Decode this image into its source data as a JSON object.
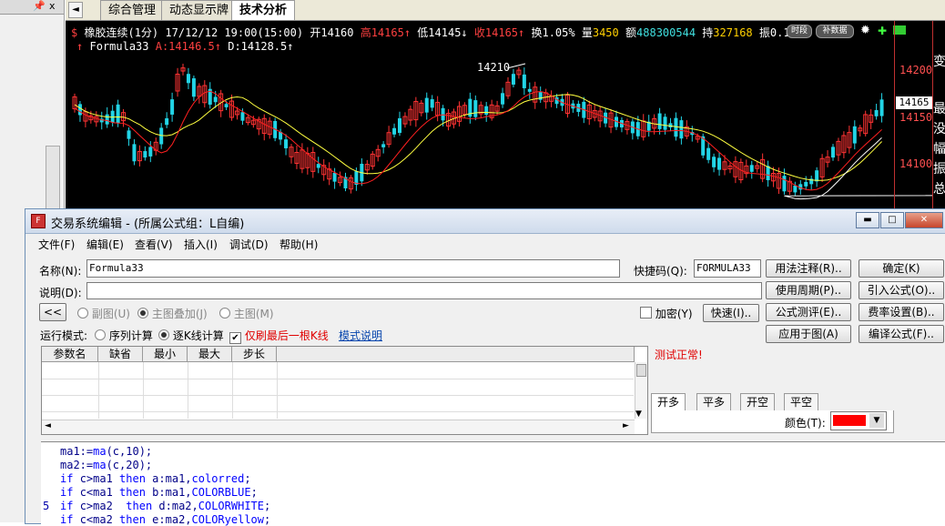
{
  "left_panel": {
    "pin_icon": "pin-icon",
    "close_label": "x"
  },
  "tabs": {
    "arrow": "◄",
    "items": [
      {
        "label": "综合管理"
      },
      {
        "label": "动态显示牌"
      },
      {
        "label": "技术分析"
      }
    ]
  },
  "chart": {
    "info_line1": {
      "dollar": "$",
      "name": "橡胶连续(1分)",
      "datetime": "17/12/12 19:00(15:00)",
      "open_label": "开14160",
      "high_label": "高14165",
      "low_label": "低14145",
      "close_label": "收14165",
      "turnover": "换1.05%",
      "volume_label": "量",
      "volume_value": "3450",
      "amount_label": "额",
      "amount_value": "488300544",
      "hold_label": "持",
      "hold_value": "327168",
      "amplitude": "振0.1",
      "btn_timeframe": "时段",
      "btn_supplement": "补数据"
    },
    "info_line2": {
      "formula": "Formula33",
      "a_value": "A:14146.5",
      "d_value": "D:14128.5"
    },
    "peak_label": "14210",
    "price_axis": [
      {
        "label": "14200"
      },
      {
        "label": "14150"
      },
      {
        "label": "14100"
      }
    ],
    "current_price": "14165",
    "right_chars": [
      "变",
      "最",
      "没",
      "幅",
      "振",
      "总"
    ],
    "colors": {
      "up": "#ff3333",
      "down": "#22d4e6",
      "ma1": "#ffff40",
      "ma2": "#ffffff",
      "ma_red": "#ff2020"
    }
  },
  "chart_data": {
    "type": "line",
    "title": "橡胶连续(1分)",
    "y_axis_ticks": [
      14200,
      14150,
      14100
    ],
    "annotations": [
      "14210",
      "14165"
    ],
    "series": [
      {
        "name": "A",
        "last_value": 14146.5
      },
      {
        "name": "D",
        "last_value": 14128.5
      }
    ]
  },
  "dialog": {
    "title": "交易系统编辑 - (所属公式组：L自编)",
    "window_buttons": {
      "minimize": "▬",
      "maximize": "□",
      "close": "✕"
    },
    "menu": [
      "文件(F)",
      "编辑(E)",
      "查看(V)",
      "插入(I)",
      "调试(D)",
      "帮助(H)"
    ],
    "name_label": "名称(N):",
    "name_value": "Formula33",
    "shortcut_label": "快捷码(Q):",
    "shortcut_value": "FORMULA33",
    "desc_label": "说明(D):",
    "desc_value": "",
    "collapse_button": "<<",
    "chart_type_options": [
      {
        "label": "副图(U)",
        "selected": false
      },
      {
        "label": "主图叠加(J)",
        "selected": true
      },
      {
        "label": "主图(M)",
        "selected": false
      }
    ],
    "encrypt_label": "加密(Y)",
    "quick_button": "快速(I)..",
    "run_mode_label": "运行模式:",
    "run_mode_options": [
      {
        "label": "序列计算",
        "selected": false
      },
      {
        "label": "逐K线计算",
        "selected": true
      }
    ],
    "refresh_last_label": "仅刷最后一根K线",
    "mode_help_link": "模式说明",
    "param_headers": [
      "参数名",
      "缺省",
      "最小",
      "最大",
      "步长"
    ],
    "test_status": "测试正常!",
    "buttons": {
      "usage_notes": "用法注释(R)..",
      "confirm": "确定(K)",
      "use_period": "使用周期(P)..",
      "import_formula": "引入公式(O)..",
      "formula_test": "公式测评(E)..",
      "fee_settings": "费率设置(B)..",
      "apply_to_chart": "应用于图(A)",
      "compile_formula": "编译公式(F).."
    },
    "signal_tabs": [
      "开多",
      "平多",
      "开空",
      "平空"
    ],
    "color_label": "颜色(T):",
    "color_value": "#ff0000",
    "code_lines": [
      {
        "num": "",
        "parts": [
          {
            "t": "ma1:=",
            "c": "st"
          },
          {
            "t": "ma",
            "c": "kw"
          },
          {
            "t": "(c,10);",
            "c": "st"
          }
        ]
      },
      {
        "num": "",
        "parts": [
          {
            "t": "ma2:=",
            "c": "st"
          },
          {
            "t": "ma",
            "c": "kw"
          },
          {
            "t": "(c,20);",
            "c": "st"
          }
        ]
      },
      {
        "num": "",
        "parts": [
          {
            "t": "if ",
            "c": "kw"
          },
          {
            "t": "c>ma1 ",
            "c": "st"
          },
          {
            "t": "then ",
            "c": "kw"
          },
          {
            "t": "a:ma1,",
            "c": "st"
          },
          {
            "t": "colorred",
            "c": "kw"
          },
          {
            "t": ";",
            "c": "st"
          }
        ]
      },
      {
        "num": "",
        "parts": [
          {
            "t": "if ",
            "c": "kw"
          },
          {
            "t": "c<ma1 ",
            "c": "st"
          },
          {
            "t": "then ",
            "c": "kw"
          },
          {
            "t": "b:ma1,",
            "c": "st"
          },
          {
            "t": "COLORBLUE",
            "c": "kw"
          },
          {
            "t": ";",
            "c": "st"
          }
        ]
      },
      {
        "num": "5",
        "parts": [
          {
            "t": "if ",
            "c": "kw"
          },
          {
            "t": "c>ma2  ",
            "c": "st"
          },
          {
            "t": "then ",
            "c": "kw"
          },
          {
            "t": "d:ma2,",
            "c": "st"
          },
          {
            "t": "COLORWHITE",
            "c": "kw"
          },
          {
            "t": ";",
            "c": "st"
          }
        ]
      },
      {
        "num": "",
        "parts": [
          {
            "t": "if ",
            "c": "kw"
          },
          {
            "t": "c<ma2 ",
            "c": "st"
          },
          {
            "t": "then ",
            "c": "kw"
          },
          {
            "t": "e:ma2,",
            "c": "st"
          },
          {
            "t": "COLORyellow",
            "c": "kw"
          },
          {
            "t": ";",
            "c": "st"
          }
        ]
      }
    ]
  }
}
